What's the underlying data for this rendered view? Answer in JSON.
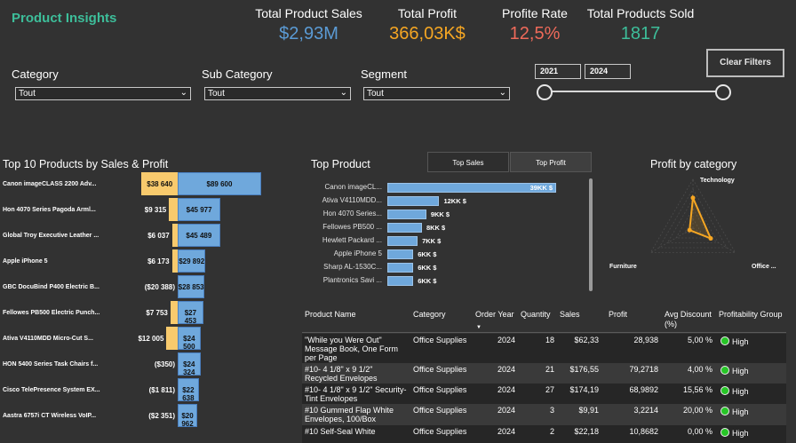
{
  "app": {
    "title": "Product Insights"
  },
  "kpis": [
    {
      "label": "Total Product Sales",
      "value": "$2,93M",
      "color": "#5b9bd5"
    },
    {
      "label": "Total Profit",
      "value": "366,03K$",
      "color": "#f5a623"
    },
    {
      "label": "Profite Rate",
      "value": "12,5%",
      "color": "#ef6a5a"
    },
    {
      "label": "Total Products Sold",
      "value": "1817",
      "color": "#3dbe9a"
    }
  ],
  "filters": {
    "category": {
      "label": "Category",
      "value": "Tout"
    },
    "sub_category": {
      "label": "Sub Category",
      "value": "Tout"
    },
    "segment": {
      "label": "Segment",
      "value": "Tout"
    },
    "year_start": "2021",
    "year_end": "2024",
    "clear_label": "Clear Filters"
  },
  "top10": {
    "title": "Top 10 Products by Sales & Profit",
    "items": [
      {
        "name": "Canon imageCLASS 2200 Adv...",
        "profit": 38640,
        "profit_label": "$38 640",
        "sales": 89600,
        "sales_label": "$89 600"
      },
      {
        "name": "Hon 4070 Series Pagoda Arml...",
        "profit": 9315,
        "profit_label": "$9 315",
        "sales": 45977,
        "sales_label": "$45 977"
      },
      {
        "name": "Global Troy Executive Leather ...",
        "profit": 6037,
        "profit_label": "$6 037",
        "sales": 45489,
        "sales_label": "$45 489"
      },
      {
        "name": "Apple iPhone 5",
        "profit": 6173,
        "profit_label": "$6 173",
        "sales": 29892,
        "sales_label": "$29 892"
      },
      {
        "name": "GBC DocuBind P400 Electric B...",
        "profit": -20388,
        "profit_label": "($20 388)",
        "sales": 28853,
        "sales_label": "$28 853"
      },
      {
        "name": "Fellowes PB500 Electric Punch...",
        "profit": 7753,
        "profit_label": "$7 753",
        "sales": 27453,
        "sales_label": "$27 453"
      },
      {
        "name": "Ativa V4110MDD Micro-Cut S...",
        "profit": 12005,
        "profit_label": "$12 005",
        "sales": 24500,
        "sales_label": "$24 500"
      },
      {
        "name": "HON 5400 Series Task Chairs f...",
        "profit": -350,
        "profit_label": "($350)",
        "sales": 24324,
        "sales_label": "$24 324"
      },
      {
        "name": "Cisco TelePresence System EX...",
        "profit": -1811,
        "profit_label": "($1 811)",
        "sales": 22638,
        "sales_label": "$22 638"
      },
      {
        "name": "Aastra 6757i CT Wireless VoIP...",
        "profit": -2351,
        "profit_label": "($2 351)",
        "sales": 20962,
        "sales_label": "$20 962"
      }
    ]
  },
  "top_product": {
    "title": "Top Product",
    "tabs": [
      "Top Sales",
      "Top Profit"
    ],
    "items": [
      {
        "name": "Canon imageCL...",
        "value": 39,
        "label": "39KK $"
      },
      {
        "name": "Ativa V4110MDD...",
        "value": 12,
        "label": "12KK $"
      },
      {
        "name": "Hon 4070 Series...",
        "value": 9,
        "label": "9KK $"
      },
      {
        "name": "Fellowes PB500 ...",
        "value": 8,
        "label": "8KK $"
      },
      {
        "name": "Hewlett Packard ...",
        "value": 7,
        "label": "7KK $"
      },
      {
        "name": "Apple iPhone 5",
        "value": 6,
        "label": "6KK $"
      },
      {
        "name": "Sharp AL-1530C...",
        "value": 6,
        "label": "6KK $"
      },
      {
        "name": "Plantronics Savi ...",
        "value": 6,
        "label": "6KK $"
      }
    ]
  },
  "profit_by_category": {
    "title": "Profit by category",
    "axes": [
      "Technology",
      "Office ...",
      "Furniture"
    ],
    "values": [
      0.62,
      0.42,
      0.08
    ]
  },
  "table": {
    "headers": [
      "Product Name",
      "Category",
      "Order Year",
      "Quantity",
      "Sales",
      "Profit",
      "Avg Discount (%)",
      "Profitability Group"
    ],
    "rows": [
      {
        "name": "\"While you Were Out\" Message Book, One Form per Page",
        "category": "Office Supplies",
        "year": "2024",
        "qty": "18",
        "sales": "$62,33",
        "profit": "28,938",
        "discount": "5,00 %",
        "group": "High"
      },
      {
        "name": "#10- 4 1/8\" x 9 1/2\" Recycled Envelopes",
        "category": "Office Supplies",
        "year": "2024",
        "qty": "21",
        "sales": "$176,55",
        "profit": "79,2718",
        "discount": "4,00 %",
        "group": "High"
      },
      {
        "name": "#10- 4 1/8\" x 9 1/2\" Security-Tint Envelopes",
        "category": "Office Supplies",
        "year": "2024",
        "qty": "27",
        "sales": "$174,19",
        "profit": "68,9892",
        "discount": "15,56 %",
        "group": "High"
      },
      {
        "name": "#10 Gummed Flap White Envelopes, 100/Box",
        "category": "Office Supplies",
        "year": "2024",
        "qty": "3",
        "sales": "$9,91",
        "profit": "3,2214",
        "discount": "20,00 %",
        "group": "High"
      },
      {
        "name": "#10 Self-Seal White",
        "category": "Office Supplies",
        "year": "2024",
        "qty": "2",
        "sales": "$22,18",
        "profit": "10,8682",
        "discount": "0,00 %",
        "group": "High"
      }
    ]
  }
}
